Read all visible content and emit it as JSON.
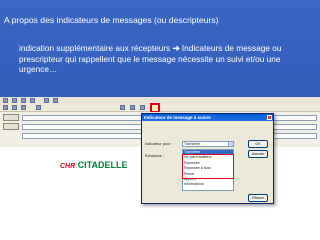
{
  "slide": {
    "title": "A propos des indicateurs de messages (ou descripteurs)",
    "body_before_arrow": "indication supplémentaire aux récepteurs ",
    "arrow": "➔",
    "body_after_arrow": " Indicateurs de message ou prescripteur qui rappellent que le message nécessite un suivi et/ou une urgence…"
  },
  "screenshot": {
    "logo_chr": "CHR",
    "logo_citadelle": "CITADELLE",
    "dialog": {
      "title": "Indicateur de message à suivre",
      "buttons": [
        "OK",
        "Annuler",
        "Effacer"
      ],
      "indicateur_label": "Indicateur pour :",
      "echeance_label": "Échéance :",
      "list_items": [
        "Transférer",
        "Ne pas transférer",
        "Répondre",
        "Répondre à tous",
        "Revoir",
        "Appeler",
        "Informations"
      ],
      "selected_index": 0
    }
  },
  "colors": {
    "background": "#2f57b5",
    "text": "#ffffff",
    "highlight": "#e2001a"
  }
}
